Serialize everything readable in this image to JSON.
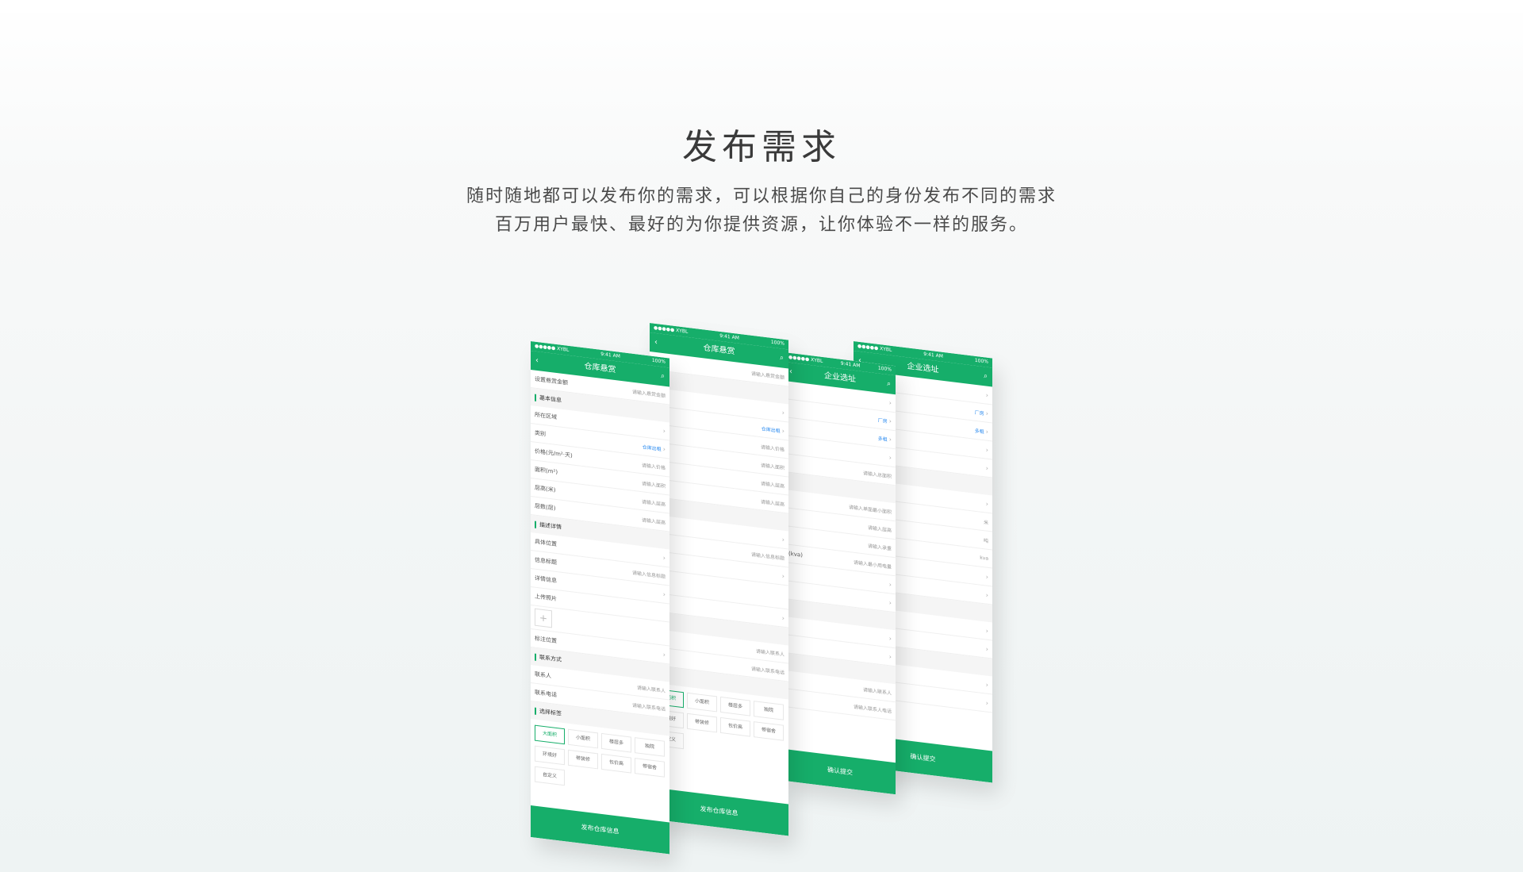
{
  "hero": {
    "title": "发布需求",
    "line1": "随时随地都可以发布你的需求，可以根据你自己的身份发布不同的需求",
    "line2": "百万用户最快、最好的为你提供资源，让你体验不一样的服务。"
  },
  "phone_common": {
    "carrier": "●●●●● XYBL",
    "time": "9:41 AM",
    "battery": "100%",
    "back_glyph": "‹",
    "search_glyph": "⌕",
    "chevron": "›"
  },
  "phone1": {
    "title": "仓库悬赏",
    "bounty_label": "设置悬赏金额",
    "bounty_placeholder": "请输入悬赏金额",
    "basic_section": "基本信息",
    "region_label": "所在区域",
    "type_label": "类别",
    "type_value": "仓库出租",
    "price_label": "价格(元/m²·天)",
    "price_placeholder": "请输入价格",
    "area_label": "面积(m²)",
    "area_placeholder": "请输入面积",
    "height_label": "层高(米)",
    "height_placeholder": "请输入层高",
    "floor_label": "层数(层)",
    "floor_placeholder": "请输入层高",
    "detail_section": "描述详情",
    "location_label": "具体位置",
    "info_title_label": "信息标题",
    "info_title_placeholder": "请输入信息标题",
    "detail_label": "详情信息",
    "upload_label": "上传照片",
    "upload_plus": "+",
    "map_label": "标注位置",
    "contact_section": "联系方式",
    "contact_label": "联系人",
    "contact_placeholder": "请输入联系人",
    "phone_label": "联系电话",
    "phone_placeholder": "请输入联系电话",
    "tag_section": "选择标签",
    "tags": [
      "大面积",
      "小面积",
      "楼层多",
      "独院",
      "环境好",
      "带装修",
      "包价高",
      "带宿舍",
      "自定义"
    ],
    "submit": "发布仓库信息"
  },
  "phone2": {
    "title": "仓库悬赏",
    "bounty_placeholder": "请输入悬赏金额",
    "type_value": "仓库出租",
    "price_placeholder": "请输入价格",
    "area_placeholder": "请输入面积",
    "height_placeholder": "请输入层高",
    "floor_placeholder": "请输入层高",
    "info_title_placeholder": "请输入信息标题",
    "contact_placeholder": "请输入联系人",
    "phone_placeholder": "请输入联系电话",
    "tags": [
      "大面积",
      "小面积",
      "楼层多",
      "独院",
      "环境好",
      "带装修",
      "包价高",
      "带宿舍",
      "自定义"
    ],
    "submit": "发布仓库信息"
  },
  "phone3": {
    "title": "企业选址",
    "type_value1": "厂房",
    "type_value2": "多租",
    "area_placeholder": "请输入总面积",
    "min_area_placeholder": "请输入单面最小面积",
    "height_placeholder": "请输入层高",
    "load_placeholder": "请输入承重",
    "power_label": "(kva)",
    "power_placeholder": "请输入最小用电量",
    "contact_placeholder": "请输入联系人",
    "phone_placeholder": "请输入联系人电话",
    "submit": "确认提交"
  },
  "phone4": {
    "title": "企业选址",
    "type_value1": "厂房",
    "type_value2": "多租",
    "unit1": "米",
    "unit2": "吨",
    "unit3": "kva",
    "submit": "确认提交"
  },
  "colors": {
    "brand": "#16ae6a",
    "link": "#2d8cf0"
  }
}
